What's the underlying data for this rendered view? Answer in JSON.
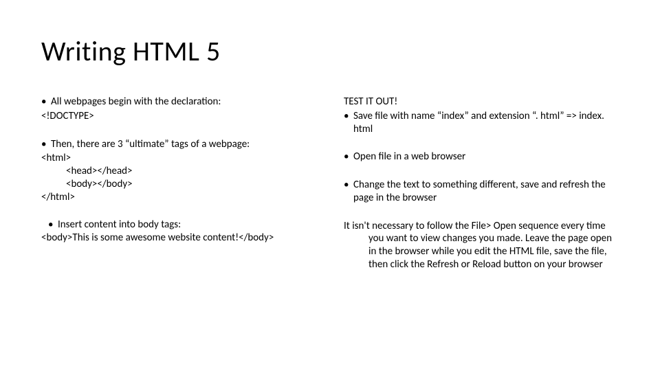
{
  "title": "Writing HTML 5",
  "left": {
    "bullet1": "All webpages begin with the declaration:",
    "doctype": "<!DOCTYPE>",
    "bullet2": "Then, there are 3 “ultimate” tags of a webpage:",
    "code_line1": "<html>",
    "code_line2": "<head></head>",
    "code_line3": "<body></body>",
    "code_line4": "</html>",
    "bullet3": "Insert content into body tags:",
    "code_body": "<body>This is some awesome website content!</body>"
  },
  "right": {
    "heading": "TEST IT OUT!",
    "bullet1": "Save  file with name “index” and extension “. html” => index. html",
    "bullet2": "Open file in a web browser",
    "bullet3": "Change the text to something different, save and refresh the page in the browser",
    "para": "It isn't necessary to follow the File> Open sequence every time you want to view changes you made. Leave the page open in the browser while you edit the HTML file, save the file, then click the Refresh or Reload button on your browser"
  }
}
